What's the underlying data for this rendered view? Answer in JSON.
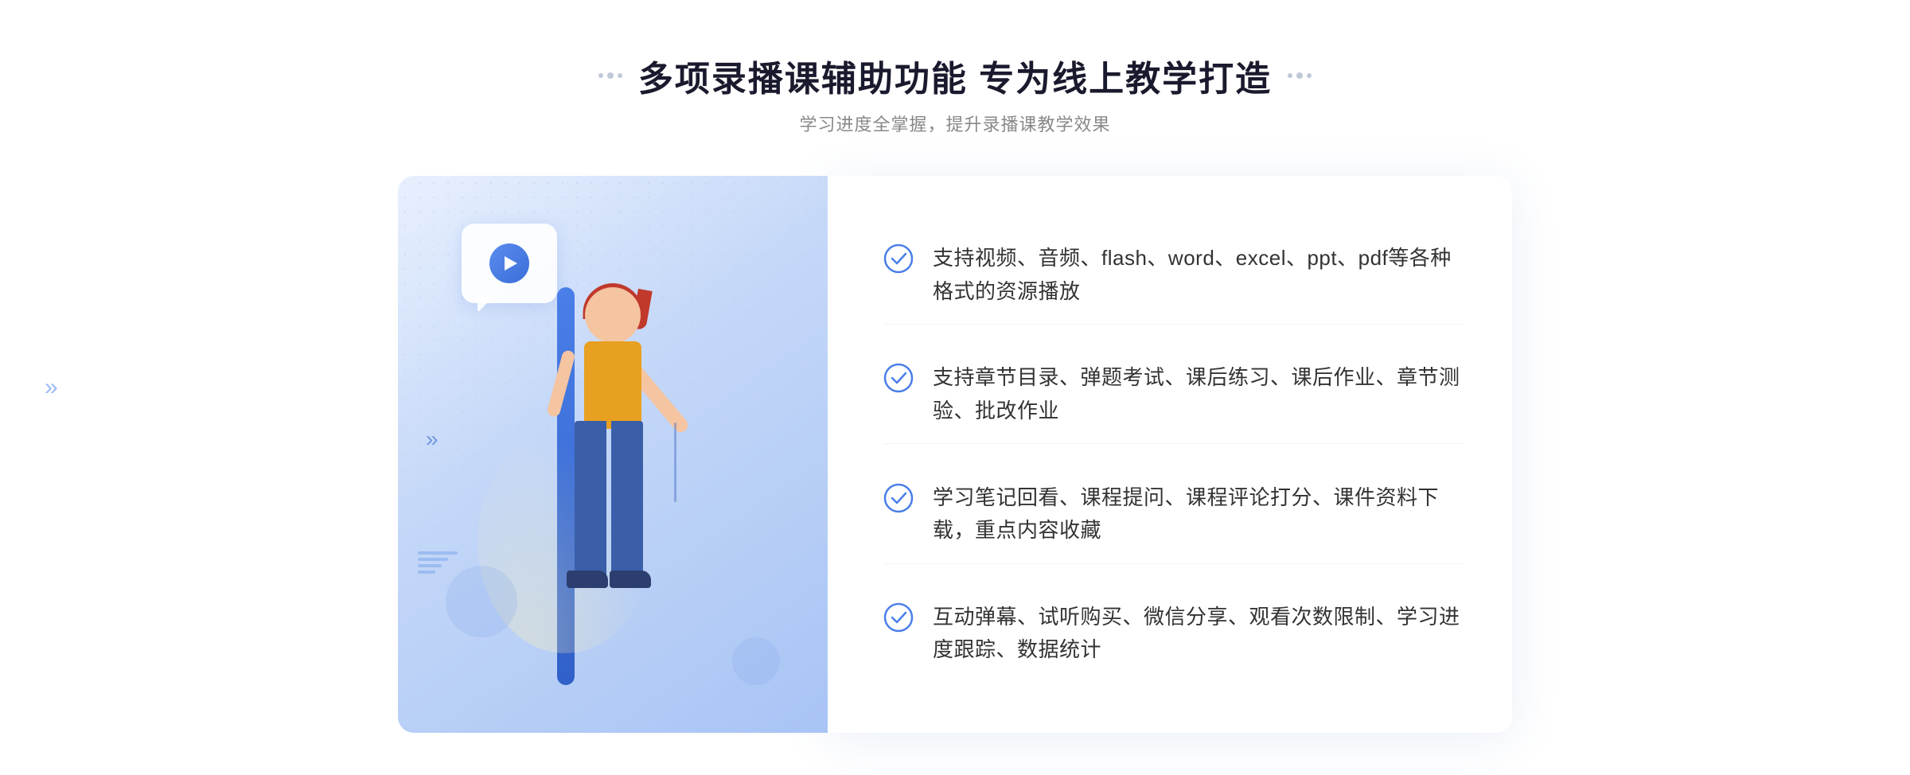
{
  "header": {
    "title": "多项录播课辅助功能 专为线上教学打造",
    "subtitle": "学习进度全掌握，提升录播课教学效果"
  },
  "features": [
    {
      "id": 1,
      "text": "支持视频、音频、flash、word、excel、ppt、pdf等各种格式的资源播放"
    },
    {
      "id": 2,
      "text": "支持章节目录、弹题考试、课后练习、课后作业、章节测验、批改作业"
    },
    {
      "id": 3,
      "text": "学习笔记回看、课程提问、课程评论打分、课件资料下载，重点内容收藏"
    },
    {
      "id": 4,
      "text": "互动弹幕、试听购买、微信分享、观看次数限制、学习进度跟踪、数据统计"
    }
  ],
  "icons": {
    "check": "check-circle-icon",
    "play": "play-icon",
    "arrows": "double-arrow-icon"
  },
  "colors": {
    "primary": "#4a7ee8",
    "secondary": "#3060c8",
    "accent": "#e8a020",
    "text_dark": "#1a1a2e",
    "text_medium": "#333",
    "text_light": "#888",
    "bg_light": "#f5f7fc"
  }
}
